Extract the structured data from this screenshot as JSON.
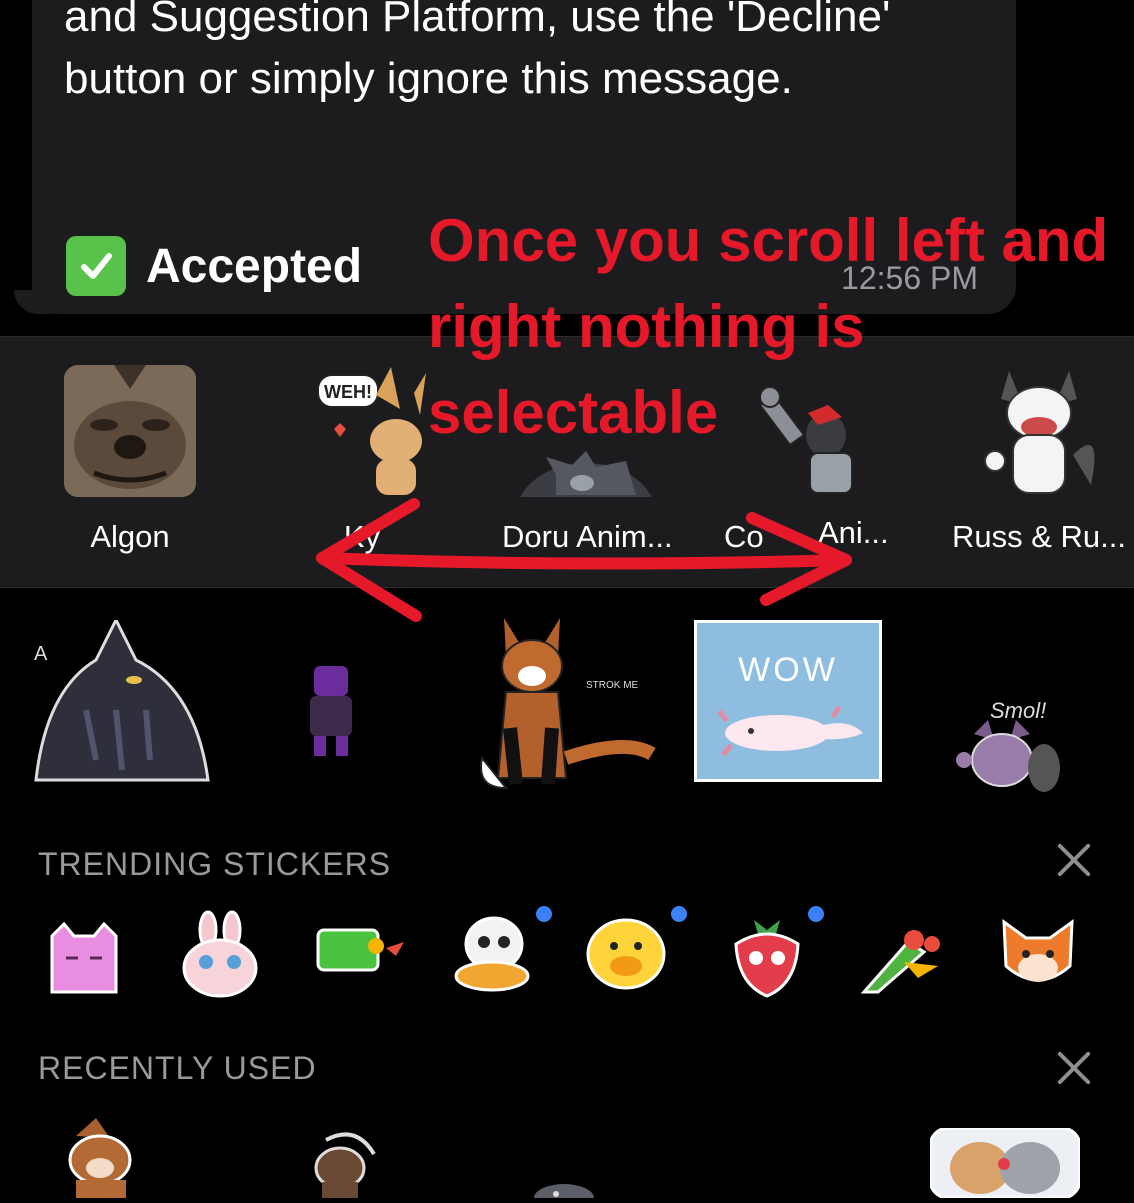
{
  "message": {
    "text": "and Suggestion Platform, use the 'Decline' button or simply ignore this message.",
    "status_icon": "check-mark-icon",
    "status_label": "Accepted",
    "timestamp": "12:56 PM"
  },
  "annotation": {
    "text": "Once you scroll left and right nothing is selectable",
    "color": "#e5192a"
  },
  "packs": [
    {
      "label": "Algon"
    },
    {
      "label": "Ky"
    },
    {
      "label": "Doru Anim..."
    },
    {
      "label": "Co"
    },
    {
      "label": "Ani..."
    },
    {
      "label": "Russ & Ru..."
    }
  ],
  "sticker_texts": {
    "wow": "WOW",
    "weh": "WEH!",
    "smol": "Smol!"
  },
  "sections": {
    "trending": "TRENDING STICKERS",
    "recent": "RECENTLY USED"
  },
  "colors": {
    "bubble_bg": "#1c1c1e",
    "strip_bg": "#1c1c1e",
    "new_dot": "#3c82f6",
    "accepted_icon": "#59c24a"
  }
}
